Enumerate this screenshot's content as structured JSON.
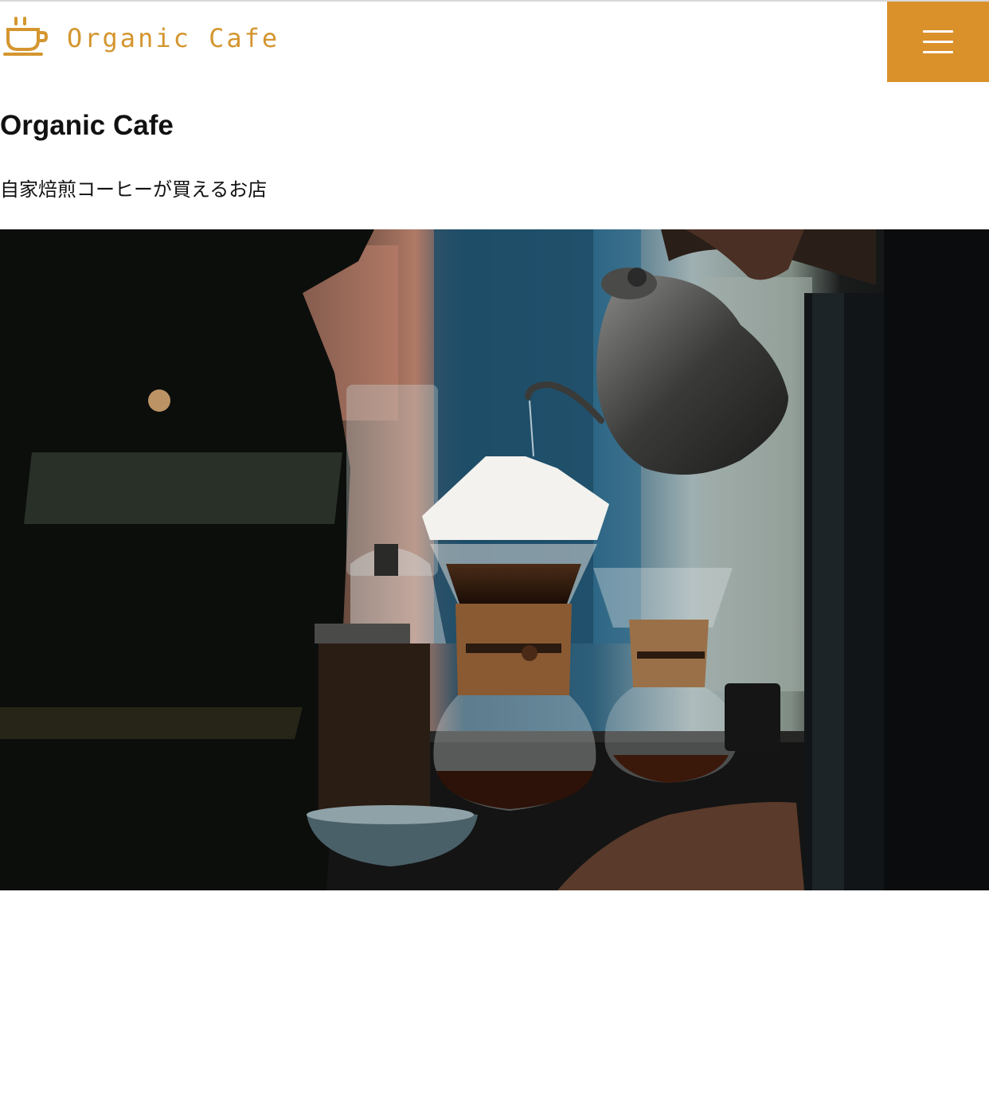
{
  "header": {
    "logo_text": "Organic Cafe",
    "logo_icon": "coffee-cup-icon",
    "menu_icon": "hamburger-icon",
    "accent_color": "#da912a"
  },
  "main": {
    "title": "Organic Cafe",
    "tagline": "自家焙煎コーヒーが買えるお店"
  },
  "hero": {
    "image_subject": "pour-over coffee being brewed"
  }
}
